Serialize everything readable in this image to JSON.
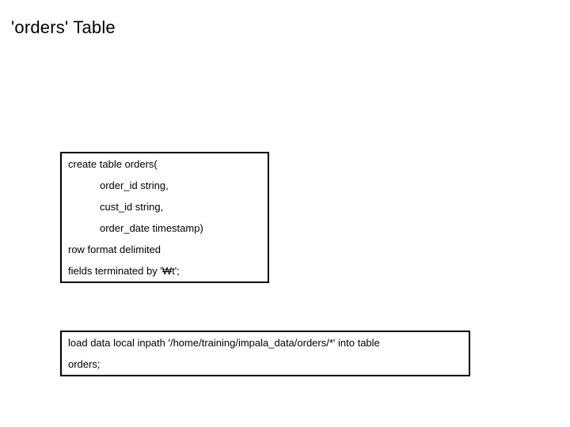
{
  "title": "'orders' Table",
  "box1": {
    "lines": [
      {
        "text": "create table orders(",
        "indent": false
      },
      {
        "text": "order_id string,",
        "indent": true
      },
      {
        "text": "cust_id string,",
        "indent": true
      },
      {
        "text": "order_date timestamp)",
        "indent": true
      },
      {
        "text": "row format delimited",
        "indent": false
      },
      {
        "text": "fields terminated by '₩t';",
        "indent": false
      }
    ]
  },
  "box2": {
    "lines": [
      {
        "text": "load data local inpath '/home/training/impala_data/orders/*' into table",
        "indent": false
      },
      {
        "text": "orders;",
        "indent": false
      }
    ]
  }
}
